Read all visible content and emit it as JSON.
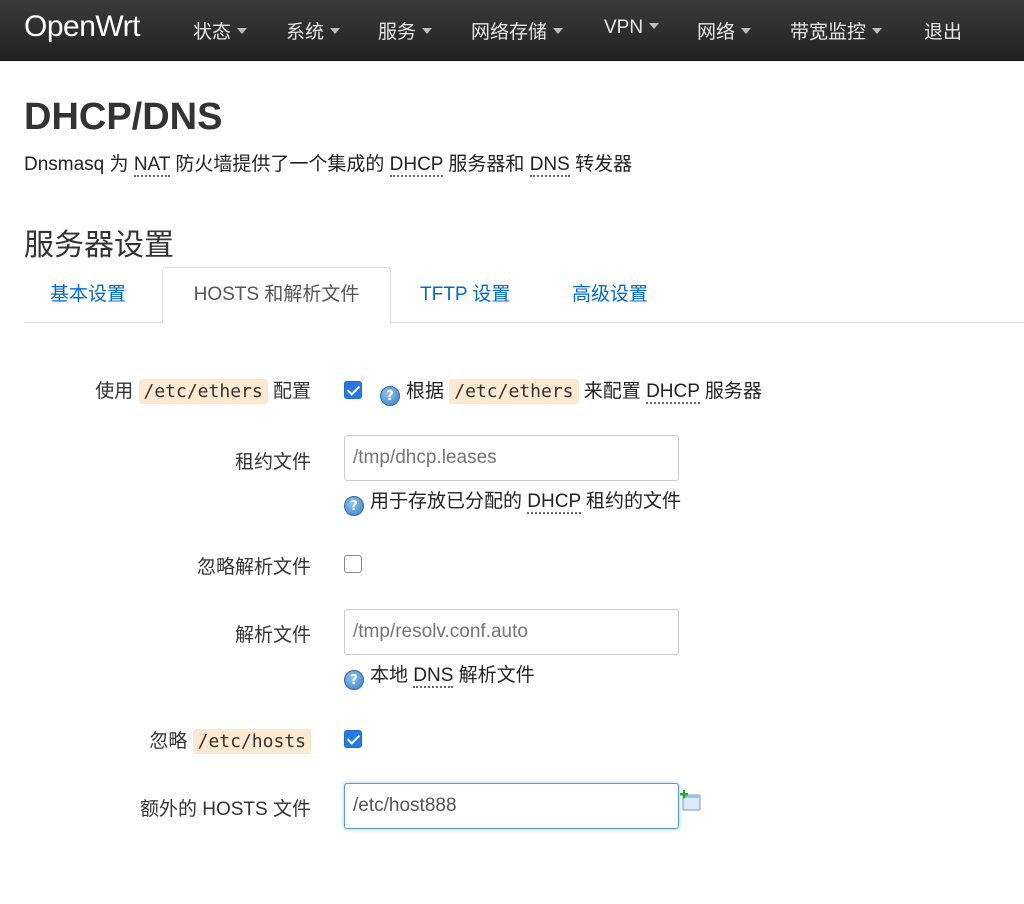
{
  "navbar": {
    "brand": "OpenWrt",
    "items": [
      {
        "label": "状态",
        "dropdown": true
      },
      {
        "label": "系统",
        "dropdown": true
      },
      {
        "label": "服务",
        "dropdown": true
      },
      {
        "label": "网络存储",
        "dropdown": true
      },
      {
        "label": "VPN",
        "dropdown": true
      },
      {
        "label": "网络",
        "dropdown": true
      },
      {
        "label": "带宽监控",
        "dropdown": true
      },
      {
        "label": "退出",
        "dropdown": false
      }
    ]
  },
  "page": {
    "title": "DHCP/DNS",
    "desc_prefix": "Dnsmasq 为 ",
    "desc_nat": "NAT",
    "desc_mid": " 防火墙提供了一个集成的 ",
    "desc_dhcp": "DHCP",
    "desc_mid2": " 服务器和 ",
    "desc_dns": "DNS",
    "desc_suffix": " 转发器"
  },
  "section": {
    "title": "服务器设置",
    "tabs": [
      {
        "label": "基本设置",
        "active": false
      },
      {
        "label": "HOSTS 和解析文件",
        "active": true
      },
      {
        "label": "TFTP 设置",
        "active": false
      },
      {
        "label": "高级设置",
        "active": false
      }
    ]
  },
  "form": {
    "ethers": {
      "label_prefix": "使用 ",
      "label_code": "/etc/ethers",
      "label_suffix": " 配置",
      "checked": true,
      "help_prefix": "根据 ",
      "help_code": "/etc/ethers",
      "help_mid": " 来配置 ",
      "help_abbr": "DHCP",
      "help_suffix": " 服务器"
    },
    "leasefile": {
      "label": "租约文件",
      "placeholder": "/tmp/dhcp.leases",
      "value": "",
      "help_prefix": "用于存放已分配的 ",
      "help_abbr": "DHCP",
      "help_suffix": " 租约的文件"
    },
    "noresolv": {
      "label": "忽略解析文件",
      "checked": false
    },
    "resolvfile": {
      "label": "解析文件",
      "placeholder": "/tmp/resolv.conf.auto",
      "value": "",
      "help_prefix": "本地 ",
      "help_abbr": "DNS",
      "help_suffix": " 解析文件"
    },
    "nohosts": {
      "label_prefix": "忽略 ",
      "label_code": "/etc/hosts",
      "checked": true
    },
    "addnhosts": {
      "label": "额外的 HOSTS 文件",
      "value": "/etc/host888"
    }
  },
  "colors": {
    "navbar_bg": "#222222",
    "link": "#0069d6",
    "checkbox_checked": "#2579e6",
    "code_bg": "#fde8d0"
  },
  "icons": {
    "help": "help-circle-icon",
    "add": "add-entry-icon"
  }
}
